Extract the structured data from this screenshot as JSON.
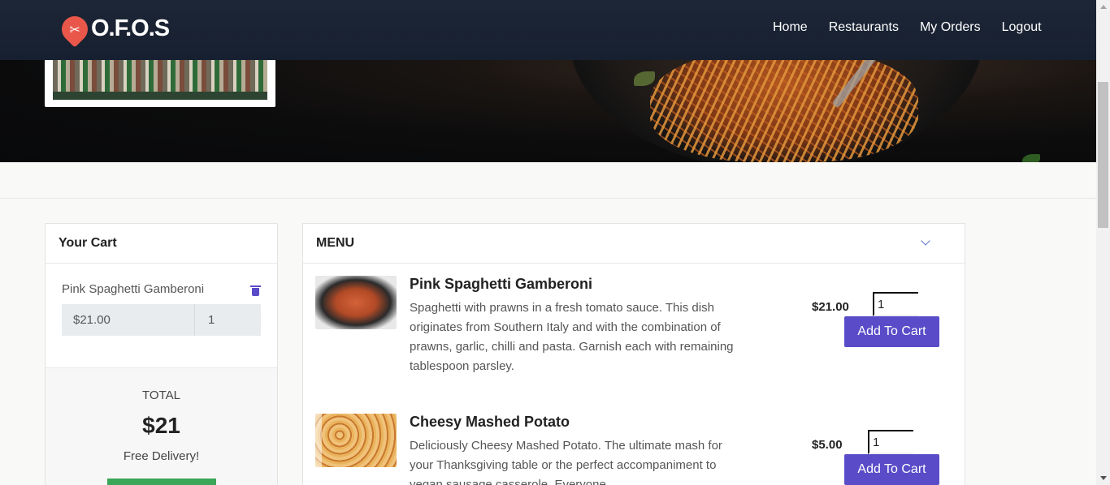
{
  "navbar": {
    "brand": "O.F.O.S",
    "brand_icon": "fork-knife-pin-icon",
    "links": [
      "Home",
      "Restaurants",
      "My Orders",
      "Logout"
    ]
  },
  "cart": {
    "title": "Your Cart",
    "items": [
      {
        "name": "Pink Spaghetti Gamberoni",
        "price": "$21.00",
        "qty": "1"
      }
    ],
    "total_label": "TOTAL",
    "total": "$21",
    "delivery_note": "Free Delivery!"
  },
  "menu": {
    "title": "MENU",
    "items": [
      {
        "name": "Pink Spaghetti Gamberoni",
        "description": "Spaghetti with prawns in a fresh tomato sauce. This dish originates from Southern Italy and with the combination of prawns, garlic, chilli and pasta. Garnish each with remaining tablespoon parsley.",
        "price": "$21.00",
        "qty": "1",
        "button": "Add To Cart"
      },
      {
        "name": "Cheesy Mashed Potato",
        "description": "Deliciously Cheesy Mashed Potato. The ultimate mash for your Thanksgiving table or the perfect accompaniment to vegan sausage casserole. Everyone",
        "price": "$5.00",
        "qty": "1",
        "button": "Add To Cart"
      }
    ]
  },
  "colors": {
    "navbar": "#1d2636",
    "accent": "#5a4bc8",
    "brand": "#e8574a",
    "checkout": "#3aa657"
  }
}
